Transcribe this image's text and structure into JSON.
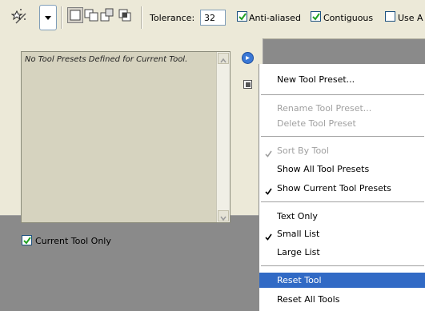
{
  "options_bar": {
    "tolerance_label": "Tolerance:",
    "tolerance_value": "32",
    "anti_aliased_label": "Anti-alias",
    "anti_aliased_suffix": "ed",
    "anti_aliased_checked": true,
    "contiguous_label": "Contiguous",
    "contiguous_checked": true,
    "use_all_label": "Use A",
    "use_all_checked": false,
    "tool_icon": "magic-wand-icon",
    "selection_modes": [
      "new-selection-icon",
      "add-to-selection-icon",
      "subtract-from-selection-icon",
      "intersect-selection-icon"
    ]
  },
  "preset_panel": {
    "empty_message": "No Tool Presets Defined for Current Tool.",
    "current_tool_only_label": "Current Tool Only",
    "current_tool_only_checked": true
  },
  "flyout_menu": {
    "items": [
      {
        "label": "New Tool Preset...",
        "disabled": false,
        "checked": false,
        "highlight": false
      },
      {
        "label": "Rename Tool Preset...",
        "disabled": true,
        "checked": false,
        "highlight": false
      },
      {
        "label": "Delete Tool Preset",
        "disabled": true,
        "checked": false,
        "highlight": false
      },
      {
        "label": "Sort By Tool",
        "disabled": true,
        "checked": true,
        "highlight": false
      },
      {
        "label": "Show All Tool Presets",
        "disabled": false,
        "checked": false,
        "highlight": false
      },
      {
        "label": "Show Current Tool Presets",
        "disabled": false,
        "checked": true,
        "highlight": false
      },
      {
        "label": "Text Only",
        "disabled": false,
        "checked": false,
        "highlight": false
      },
      {
        "label": "Small List",
        "disabled": false,
        "checked": true,
        "highlight": false
      },
      {
        "label": "Large List",
        "disabled": false,
        "checked": false,
        "highlight": false
      },
      {
        "label": "Reset Tool",
        "disabled": false,
        "checked": false,
        "highlight": true
      },
      {
        "label": "Reset All Tools",
        "disabled": false,
        "checked": false,
        "highlight": false
      }
    ]
  },
  "colors": {
    "highlight": "#316ac5",
    "panel_bg": "#ece9d8",
    "workspace_bg": "#8a8a8a"
  }
}
